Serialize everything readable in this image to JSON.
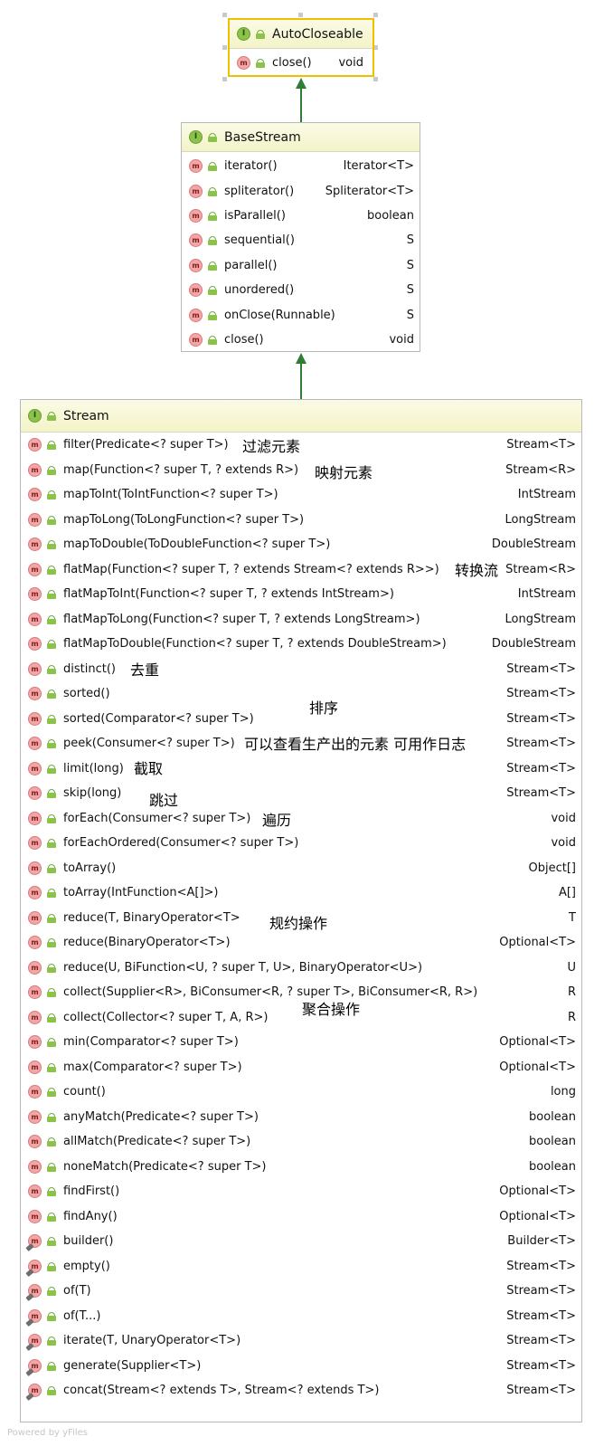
{
  "auto_closeable": {
    "name": "AutoCloseable",
    "methods": [
      {
        "sig": "close()",
        "ret": "void"
      }
    ]
  },
  "base_stream": {
    "name": "BaseStream",
    "methods": [
      {
        "sig": "iterator()",
        "ret": "Iterator<T>"
      },
      {
        "sig": "spliterator()",
        "ret": "Spliterator<T>"
      },
      {
        "sig": "isParallel()",
        "ret": "boolean"
      },
      {
        "sig": "sequential()",
        "ret": "S"
      },
      {
        "sig": "parallel()",
        "ret": "S"
      },
      {
        "sig": "unordered()",
        "ret": "S"
      },
      {
        "sig": "onClose(Runnable)",
        "ret": "S"
      },
      {
        "sig": "close()",
        "ret": "void"
      }
    ]
  },
  "stream": {
    "name": "Stream",
    "methods": [
      {
        "sig": "filter(Predicate<? super T>)",
        "ret": "Stream<T>"
      },
      {
        "sig": "map(Function<? super T, ? extends R>)",
        "ret": "Stream<R>"
      },
      {
        "sig": "mapToInt(ToIntFunction<? super T>)",
        "ret": "IntStream"
      },
      {
        "sig": "mapToLong(ToLongFunction<? super T>)",
        "ret": "LongStream"
      },
      {
        "sig": "mapToDouble(ToDoubleFunction<? super T>)",
        "ret": "DoubleStream"
      },
      {
        "sig": "flatMap(Function<? super T, ? extends Stream<? extends R>>)",
        "ret": "Stream<R>"
      },
      {
        "sig": "flatMapToInt(Function<? super T, ? extends IntStream>)",
        "ret": "IntStream"
      },
      {
        "sig": "flatMapToLong(Function<? super T, ? extends LongStream>)",
        "ret": "LongStream"
      },
      {
        "sig": "flatMapToDouble(Function<? super T, ? extends DoubleStream>)",
        "ret": "DoubleStream"
      },
      {
        "sig": "distinct()",
        "ret": "Stream<T>"
      },
      {
        "sig": "sorted()",
        "ret": "Stream<T>"
      },
      {
        "sig": "sorted(Comparator<? super T>)",
        "ret": "Stream<T>"
      },
      {
        "sig": "peek(Consumer<? super T>)",
        "ret": "Stream<T>"
      },
      {
        "sig": "limit(long)",
        "ret": "Stream<T>"
      },
      {
        "sig": "skip(long)",
        "ret": "Stream<T>"
      },
      {
        "sig": "forEach(Consumer<? super T>)",
        "ret": "void"
      },
      {
        "sig": "forEachOrdered(Consumer<? super T>)",
        "ret": "void"
      },
      {
        "sig": "toArray()",
        "ret": "Object[]"
      },
      {
        "sig": "toArray(IntFunction<A[]>)",
        "ret": "A[]"
      },
      {
        "sig": "reduce(T, BinaryOperator<T>",
        "ret": "T"
      },
      {
        "sig": "reduce(BinaryOperator<T>)",
        "ret": "Optional<T>"
      },
      {
        "sig": "reduce(U, BiFunction<U, ? super T, U>, BinaryOperator<U>)",
        "ret": "U"
      },
      {
        "sig": "collect(Supplier<R>, BiConsumer<R, ? super T>, BiConsumer<R, R>)",
        "ret": "R"
      },
      {
        "sig": "collect(Collector<? super T, A, R>)",
        "ret": "R"
      },
      {
        "sig": "min(Comparator<? super T>)",
        "ret": "Optional<T>"
      },
      {
        "sig": "max(Comparator<? super T>)",
        "ret": "Optional<T>"
      },
      {
        "sig": "count()",
        "ret": "long"
      },
      {
        "sig": "anyMatch(Predicate<? super T>)",
        "ret": "boolean"
      },
      {
        "sig": "allMatch(Predicate<? super T>)",
        "ret": "boolean"
      },
      {
        "sig": "noneMatch(Predicate<? super T>)",
        "ret": "boolean"
      },
      {
        "sig": "findFirst()",
        "ret": "Optional<T>"
      },
      {
        "sig": "findAny()",
        "ret": "Optional<T>"
      },
      {
        "sig": "builder()",
        "ret": "Builder<T>"
      },
      {
        "sig": "empty()",
        "ret": "Stream<T>"
      },
      {
        "sig": "of(T)",
        "ret": "Stream<T>"
      },
      {
        "sig": "of(T...)",
        "ret": "Stream<T>"
      },
      {
        "sig": "iterate(T, UnaryOperator<T>)",
        "ret": "Stream<T>"
      },
      {
        "sig": "generate(Supplier<T>)",
        "ret": "Stream<T>"
      },
      {
        "sig": "concat(Stream<? extends T>, Stream<? extends T>)",
        "ret": "Stream<T>"
      }
    ]
  },
  "annotations": {
    "filter": "过滤元素",
    "map": "映射元素",
    "flatmap": "转换流",
    "distinct": "去重",
    "sorted": "排序",
    "peek": "可以查看生产出的元素 可用作日志",
    "limit": "截取",
    "skip": "跳过",
    "foreach": "遍历",
    "reduce": "规约操作",
    "collect": "聚合操作"
  },
  "badges": {
    "interface": "I",
    "method": "m"
  },
  "footer": "Powered by yFiles",
  "colors": {
    "header_bg": "#f3f3c8",
    "selected_border": "#f0c000",
    "arrow": "#2e7d32",
    "interface_badge": "#8bc34a",
    "method_badge": "#f4a6a6"
  }
}
